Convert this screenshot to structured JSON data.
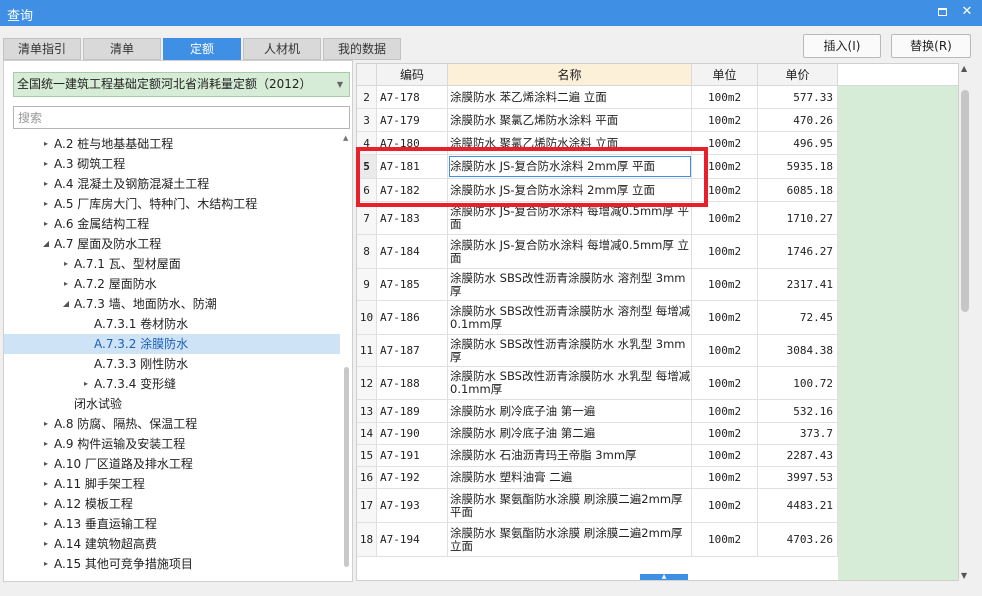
{
  "window": {
    "title": "查询"
  },
  "tabs": [
    {
      "label": "清单指引",
      "active": false
    },
    {
      "label": "清单",
      "active": false
    },
    {
      "label": "定额",
      "active": true
    },
    {
      "label": "人材机",
      "active": false
    },
    {
      "label": "我的数据",
      "active": false
    }
  ],
  "buttons": {
    "insert": "插入(I)",
    "replace": "替换(R)"
  },
  "left": {
    "quota_library": "全国统一建筑工程基础定额河北省消耗量定额（2012）",
    "search_placeholder": "搜索",
    "tree": [
      {
        "label": "A.2 桩与地基基础工程",
        "toggle": "▸"
      },
      {
        "label": "A.3 砌筑工程",
        "toggle": "▸"
      },
      {
        "label": "A.4 混凝土及钢筋混凝土工程",
        "toggle": "▸"
      },
      {
        "label": "A.5 厂库房大门、特种门、木结构工程",
        "toggle": "▸"
      },
      {
        "label": "A.6 金属结构工程",
        "toggle": "▸"
      },
      {
        "label": "A.7 屋面及防水工程",
        "toggle": "◢"
      },
      {
        "label": "A.7.1 瓦、型材屋面",
        "toggle": "▸"
      },
      {
        "label": "A.7.2 屋面防水",
        "toggle": "▸"
      },
      {
        "label": "A.7.3 墙、地面防水、防潮",
        "toggle": "◢"
      },
      {
        "label": "A.7.3.1 卷材防水",
        "toggle": ""
      },
      {
        "label": "A.7.3.2 涂膜防水",
        "toggle": "",
        "selected": true
      },
      {
        "label": "A.7.3.3 刚性防水",
        "toggle": ""
      },
      {
        "label": "A.7.3.4 变形缝",
        "toggle": "▸"
      },
      {
        "label": "闭水试验",
        "toggle": ""
      },
      {
        "label": "A.8 防腐、隔热、保温工程",
        "toggle": "▸"
      },
      {
        "label": "A.9 构件运输及安装工程",
        "toggle": "▸"
      },
      {
        "label": "A.10 厂区道路及排水工程",
        "toggle": "▸"
      },
      {
        "label": "A.11 脚手架工程",
        "toggle": "▸"
      },
      {
        "label": "A.12 模板工程",
        "toggle": "▸"
      },
      {
        "label": "A.13 垂直运输工程",
        "toggle": "▸"
      },
      {
        "label": "A.14 建筑物超高费",
        "toggle": "▸"
      },
      {
        "label": "A.15 其他可竞争措施项目",
        "toggle": "▸"
      }
    ]
  },
  "table": {
    "headers": {
      "code": "编码",
      "name": "名称",
      "unit": "单位",
      "price": "单价"
    },
    "rows": [
      {
        "idx": "2",
        "code": "A7-178",
        "name": "涂膜防水 苯乙烯涂料二遍 立面",
        "unit": "100m2",
        "price": "577.33"
      },
      {
        "idx": "3",
        "code": "A7-179",
        "name": "涂膜防水 聚氯乙烯防水涂料 平面",
        "unit": "100m2",
        "price": "470.26"
      },
      {
        "idx": "4",
        "code": "A7-180",
        "name": "涂膜防水 聚氯乙烯防水涂料 立面",
        "unit": "100m2",
        "price": "496.95"
      },
      {
        "idx": "5",
        "code": "A7-181",
        "name": "涂膜防水 JS-复合防水涂料 2mm厚 平面",
        "unit": "100m2",
        "price": "5935.18",
        "current": true
      },
      {
        "idx": "6",
        "code": "A7-182",
        "name": "涂膜防水 JS-复合防水涂料 2mm厚 立面",
        "unit": "100m2",
        "price": "6085.18"
      },
      {
        "idx": "7",
        "code": "A7-183",
        "name": "涂膜防水 JS-复合防水涂料 每增减0.5mm厚 平面",
        "unit": "100m2",
        "price": "1710.27"
      },
      {
        "idx": "8",
        "code": "A7-184",
        "name": "涂膜防水 JS-复合防水涂料 每增减0.5mm厚 立面",
        "unit": "100m2",
        "price": "1746.27"
      },
      {
        "idx": "9",
        "code": "A7-185",
        "name": "涂膜防水 SBS改性沥青涂膜防水 溶剂型 3mm厚",
        "unit": "100m2",
        "price": "2317.41"
      },
      {
        "idx": "10",
        "code": "A7-186",
        "name": "涂膜防水 SBS改性沥青涂膜防水 溶剂型 每增减0.1mm厚",
        "unit": "100m2",
        "price": "72.45"
      },
      {
        "idx": "11",
        "code": "A7-187",
        "name": "涂膜防水 SBS改性沥青涂膜防水 水乳型 3mm厚",
        "unit": "100m2",
        "price": "3084.38"
      },
      {
        "idx": "12",
        "code": "A7-188",
        "name": "涂膜防水 SBS改性沥青涂膜防水 水乳型 每增减0.1mm厚",
        "unit": "100m2",
        "price": "100.72"
      },
      {
        "idx": "13",
        "code": "A7-189",
        "name": "涂膜防水 刷冷底子油 第一遍",
        "unit": "100m2",
        "price": "532.16"
      },
      {
        "idx": "14",
        "code": "A7-190",
        "name": "涂膜防水 刷冷底子油 第二遍",
        "unit": "100m2",
        "price": "373.7"
      },
      {
        "idx": "15",
        "code": "A7-191",
        "name": "涂膜防水 石油沥青玛王帝脂 3mm厚",
        "unit": "100m2",
        "price": "2287.43"
      },
      {
        "idx": "16",
        "code": "A7-192",
        "name": "涂膜防水 塑料油膏 二遍",
        "unit": "100m2",
        "price": "3997.53"
      },
      {
        "idx": "17",
        "code": "A7-193",
        "name": "涂膜防水 聚氨酯防水涂膜 刷涂膜二遍2mm厚 平面",
        "unit": "100m2",
        "price": "4483.21"
      },
      {
        "idx": "18",
        "code": "A7-194",
        "name": "涂膜防水 聚氨酯防水涂膜 刷涂膜二遍2mm厚 立面",
        "unit": "100m2",
        "price": "4703.26"
      }
    ]
  },
  "colors": {
    "accent": "#3f8fe4",
    "highlight": "#e8202a",
    "green": "#d6ecd6"
  }
}
